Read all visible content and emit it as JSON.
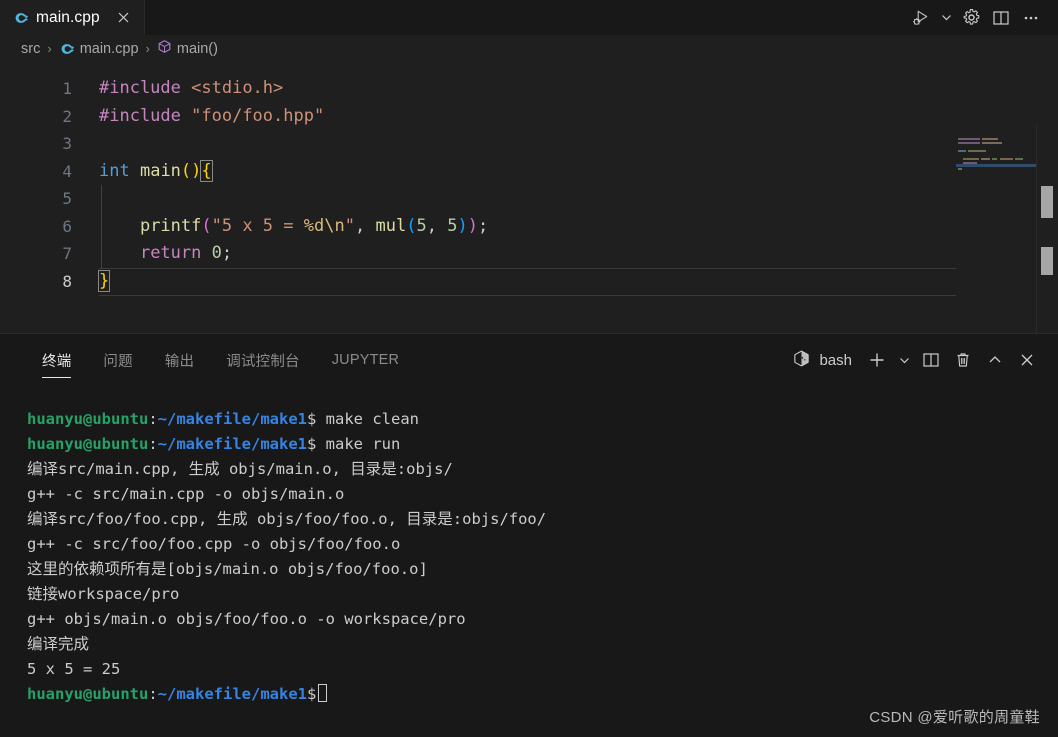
{
  "colors": {
    "tabbar_bg": "#181818",
    "tab_bg": "#1f1f1f",
    "editor_bg": "#1f1f1f",
    "panel_bg": "#181818",
    "accent_green": "#26a269",
    "accent_blue": "#3584e4",
    "keyword": "#569cd6",
    "function": "#dcdcaa",
    "string": "#ce9178",
    "preprocessor": "#c586c0",
    "number": "#b5cea8",
    "bracket1": "#ffd700",
    "bracket2": "#da70d6",
    "bracket3": "#179fff"
  },
  "tabbar": {
    "tabs": [
      {
        "label": "main.cpp",
        "icon": "cpp-file-icon",
        "close": "×",
        "active": true
      }
    ],
    "actions": [
      {
        "name": "run-and-debug-icon",
        "title": "Run or Debug..."
      },
      {
        "name": "chevron-down-icon",
        "title": "More run options"
      },
      {
        "name": "gear-icon",
        "title": "Settings"
      },
      {
        "name": "split-editor-icon",
        "title": "Split Editor"
      },
      {
        "name": "more-actions-icon",
        "title": "More Actions..."
      }
    ]
  },
  "breadcrumb": {
    "items": [
      {
        "label": "src",
        "icon": ""
      },
      {
        "label": "main.cpp",
        "icon": "cpp-file-icon"
      },
      {
        "label": "main()",
        "icon": "symbol-method-icon"
      }
    ],
    "separator": "›"
  },
  "editor": {
    "language": "cpp",
    "lines": [
      {
        "num": "1",
        "text": "#include <stdio.h>"
      },
      {
        "num": "2",
        "text": "#include \"foo/foo.hpp\""
      },
      {
        "num": "3",
        "text": ""
      },
      {
        "num": "4",
        "text": "int main(){"
      },
      {
        "num": "5",
        "text": ""
      },
      {
        "num": "6",
        "text": "    printf(\"5 x 5 = %d\\n\", mul(5, 5));"
      },
      {
        "num": "7",
        "text": "    return 0;"
      },
      {
        "num": "8",
        "text": "}"
      }
    ],
    "cursor_line": "8"
  },
  "panel": {
    "tabs": [
      {
        "label": "终端",
        "active": true
      },
      {
        "label": "问题",
        "active": false
      },
      {
        "label": "输出",
        "active": false
      },
      {
        "label": "调试控制台",
        "active": false
      },
      {
        "label": "JUPYTER",
        "active": false
      }
    ],
    "shell": {
      "label": "bash",
      "icon": "terminal-bash-icon"
    },
    "actions": [
      {
        "name": "new-terminal-icon",
        "title": "New Terminal"
      },
      {
        "name": "chevron-down-icon",
        "title": "Launch Profile..."
      },
      {
        "name": "split-terminal-icon",
        "title": "Split Terminal"
      },
      {
        "name": "kill-terminal-icon",
        "title": "Kill Terminal"
      },
      {
        "name": "maximize-panel-icon",
        "title": "Maximize Panel Size"
      },
      {
        "name": "close-panel-icon",
        "title": "Close Panel"
      }
    ]
  },
  "terminal": {
    "prompt": {
      "user_host": "huanyu@ubuntu",
      "colon": ":",
      "path": "~/makefile/make1",
      "dollar": "$"
    },
    "lines": [
      {
        "type": "prompt",
        "command": " make clean"
      },
      {
        "type": "prompt",
        "command": " make run"
      },
      {
        "type": "output",
        "text": "编译src/main.cpp, 生成 objs/main.o, 目录是:objs/"
      },
      {
        "type": "output",
        "text": "g++ -c src/main.cpp -o objs/main.o"
      },
      {
        "type": "output",
        "text": "编译src/foo/foo.cpp, 生成 objs/foo/foo.o, 目录是:objs/foo/"
      },
      {
        "type": "output",
        "text": "g++ -c src/foo/foo.cpp -o objs/foo/foo.o"
      },
      {
        "type": "output",
        "text": "这里的依赖项所有是[objs/main.o objs/foo/foo.o]"
      },
      {
        "type": "output",
        "text": "链接workspace/pro"
      },
      {
        "type": "output",
        "text": "g++ objs/main.o objs/foo/foo.o -o workspace/pro"
      },
      {
        "type": "output",
        "text": "编译完成"
      },
      {
        "type": "output",
        "text": "5 x 5 = 25"
      },
      {
        "type": "prompt",
        "command": "",
        "cursor": true
      }
    ]
  },
  "watermark": {
    "text": "CSDN @爱听歌的周童鞋"
  }
}
